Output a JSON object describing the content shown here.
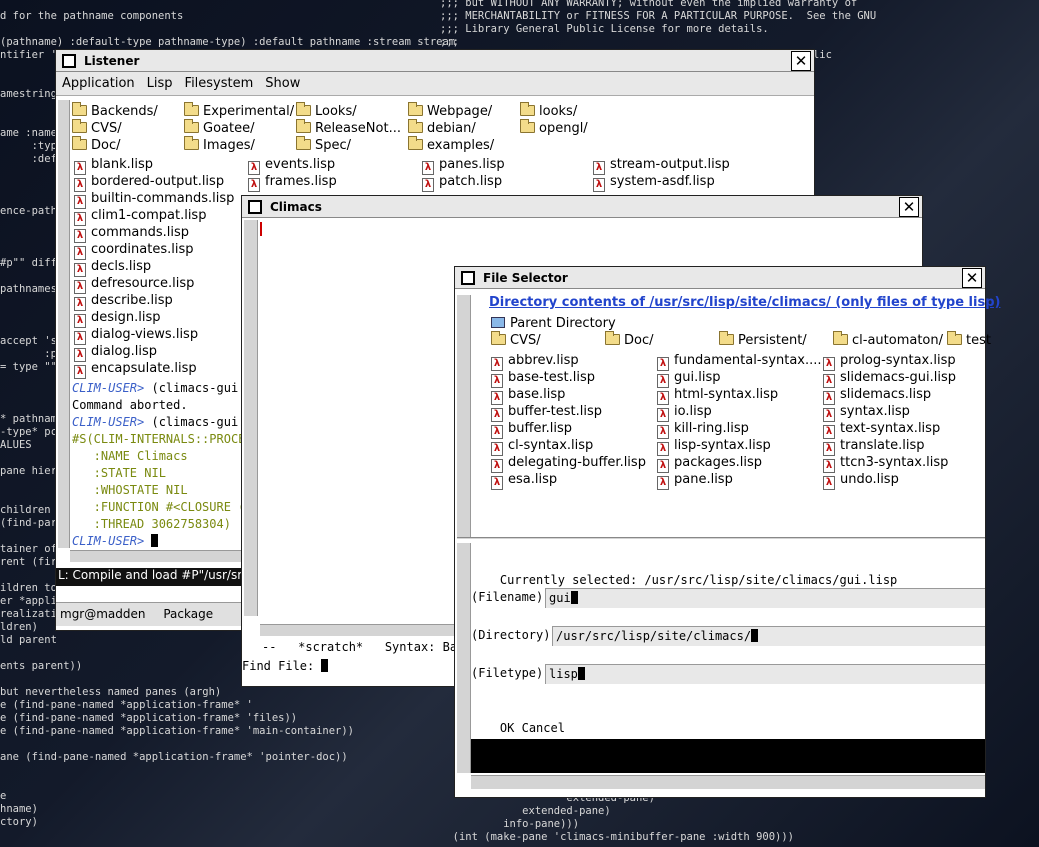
{
  "background_text_left": [
    "d for the pathname components",
    "",
    "(pathname) :default-type pathname-type) :default pathname :stream stream",
    "ntifier '",
    "",
    "",
    "amestring",
    "",
    "",
    "ame :name",
    "     :type",
    "     :defc",
    "",
    "",
    "",
    "ence-path",
    "",
    "",
    "",
    "#p\"\" diff",
    "",
    "pathnames",
    "",
    "",
    "",
    "accept 's",
    "       :p",
    "= type \"\"",
    "",
    "",
    "",
    "* pathnam",
    "-type* pc",
    "ALUES",
    "",
    "pane hier",
    "",
    "",
    "children",
    "(find-par",
    "",
    "tainer of",
    "rent (fir",
    "",
    "ildren to",
    "er *appli",
    "realizati",
    "ldren)",
    "ld parent",
    "",
    "ents parent))",
    "",
    "but nevertheless named panes (argh)",
    "e (find-pane-named *application-frame* '",
    "e (find-pane-named *application-frame* 'files))",
    "e (find-pane-named *application-frame* 'main-container))",
    "",
    "ane (find-pane-named *application-frame* 'pointer-doc))",
    "",
    "",
    "e",
    "hname)",
    "ctory)"
  ],
  "background_text_right_top": [
    ";;; but WITHOUT ANY WARRANTY; without even the implied warranty of",
    ";;; MERCHANTABILITY or FITNESS FOR A PARTICULAR PURPOSE.  See the GNU",
    ";;; Library General Public License for more details.",
    ";;;",
    ";;;                                                     Public"
  ],
  "background_text_right_bottom": [
    "                    extended-pane)",
    "             extended-pane)",
    "          info-pane)))",
    "  (int (make-pane 'climacs-minibuffer-pane :width 900)))"
  ],
  "listener": {
    "title": "Listener",
    "menu": [
      "Application",
      "Lisp",
      "Filesystem",
      "Show"
    ],
    "folders": [
      "Backends/",
      "Experimental/",
      "Looks/",
      "Webpage/",
      "looks/",
      "CVS/",
      "Goatee/",
      "ReleaseNot...",
      "debian/",
      "opengl/",
      "Doc/",
      "Images/",
      "Spec/",
      "examples/"
    ],
    "files_col1": [
      "blank.lisp",
      "bordered-output.lisp",
      "builtin-commands.lisp",
      "clim1-compat.lisp",
      "commands.lisp",
      "coordinates.lisp",
      "decls.lisp",
      "defresource.lisp",
      "describe.lisp",
      "design.lisp",
      "dialog-views.lisp",
      "dialog.lisp",
      "encapsulate.lisp"
    ],
    "files_col2": [
      "events.lisp",
      "frames.lisp"
    ],
    "files_col3": [
      "panes.lisp",
      "patch.lisp"
    ],
    "files_col4": [
      "stream-output.lisp",
      "system-asdf.lisp"
    ],
    "repl": [
      {
        "prompt": "CLIM-USER>",
        "text": " (climacs-gui:c"
      },
      {
        "prompt": "",
        "text": "Command aborted."
      },
      {
        "prompt": "CLIM-USER>",
        "text": " (climacs-gui:c"
      },
      {
        "prompt": "",
        "text": "#S(CLIM-INTERNALS::PROCE"
      },
      {
        "prompt": "",
        "text": "   :NAME Climacs"
      },
      {
        "prompt": "",
        "text": "   :STATE NIL"
      },
      {
        "prompt": "",
        "text": "   :WHOSTATE NIL"
      },
      {
        "prompt": "",
        "text": "   :FUNCTION #<CLOSURE ("
      },
      {
        "prompt": "",
        "text": "   :THREAD 3062758304)"
      },
      {
        "prompt": "CLIM-USER>",
        "text": " "
      }
    ],
    "doc_line": "L: Compile and load #P\"/usr/sr",
    "status_user": "mgr@madden",
    "status_package": "Package"
  },
  "climacs": {
    "title": "Climacs",
    "modeline": "--   *scratch*   Syntax: Ba",
    "minibuffer": "Find File: "
  },
  "file_selector": {
    "title": "File Selector",
    "heading": "Directory contents of /usr/src/lisp/site/climacs/ (only files of type lisp)",
    "parent": "Parent Directory",
    "folders": [
      "CVS/",
      "Doc/",
      "Persistent/",
      "cl-automaton/",
      "test"
    ],
    "files_col1": [
      "abbrev.lisp",
      "base-test.lisp",
      "base.lisp",
      "buffer-test.lisp",
      "buffer.lisp",
      "cl-syntax.lisp",
      "delegating-buffer.lisp",
      "esa.lisp"
    ],
    "files_col2": [
      "fundamental-syntax....",
      "gui.lisp",
      "html-syntax.lisp",
      "io.lisp",
      "kill-ring.lisp",
      "lisp-syntax.lisp",
      "packages.lisp",
      "pane.lisp"
    ],
    "files_col3": [
      "prolog-syntax.lisp",
      "slidemacs-gui.lisp",
      "slidemacs.lisp",
      "syntax.lisp",
      "text-syntax.lisp",
      "translate.lisp",
      "ttcn3-syntax.lisp",
      "undo.lisp"
    ],
    "currently_selected_label": "Currently selected:",
    "currently_selected_value": "/usr/src/lisp/site/climacs/gui.lisp",
    "filename_label": "(Filename)",
    "filename_value": "gui",
    "directory_label": "(Directory)",
    "directory_value": "/usr/src/lisp/site/climacs/",
    "filetype_label": "(Filetype)",
    "filetype_value": "lisp",
    "ok_label": "OK",
    "cancel_label": "Cancel"
  }
}
